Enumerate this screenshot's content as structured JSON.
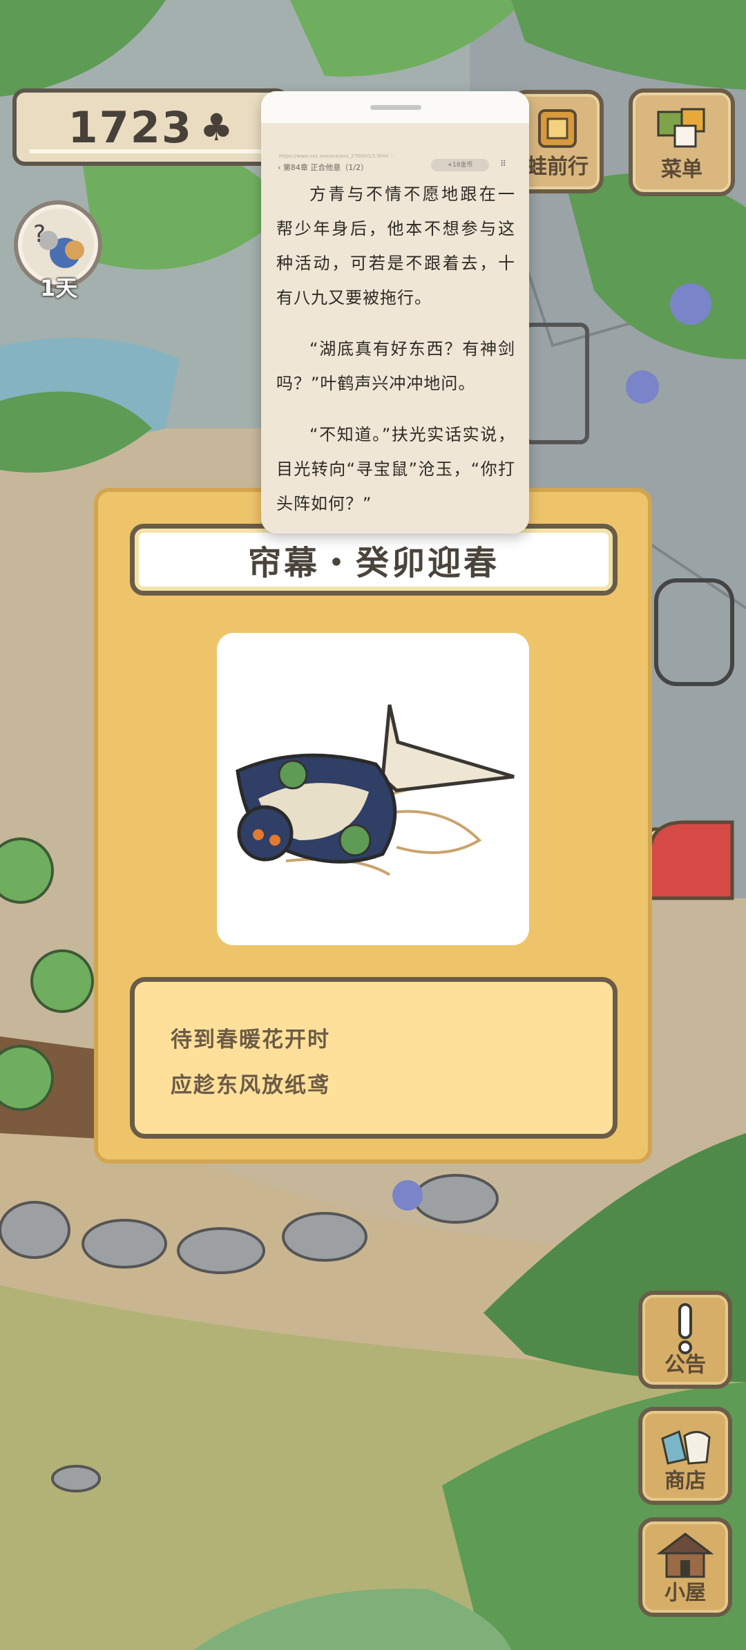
{
  "counter": {
    "value": "1723",
    "icon": "clover-icon"
  },
  "day_badge": {
    "label": "1天"
  },
  "top_buttons": [
    {
      "name": "frog-travel",
      "label": "蛙前行"
    },
    {
      "name": "menu",
      "label": "菜单"
    }
  ],
  "reader": {
    "url": "https://www.xxx.xxx/xxx/xxx_27000/1/1.html ···",
    "chapter": "‹ 第84章 正合他意（1/2）",
    "coin_pill": "+18金币",
    "paragraphs": [
      "方青与不情不愿地跟在一帮少年身后，他本不想参与这种活动，可若是不跟着去，十有八九又要被拖行。",
      "“湖底真有好东西？有神剑吗？”叶鹤声兴冲冲地问。",
      "“不知道。”扶光实话实说，目光转向“寻宝鼠”沧玉，“你打头阵如何？”"
    ]
  },
  "card": {
    "title": "帘幕・癸卯迎春",
    "image_icon": "swallow-kite-icon",
    "desc_lines": [
      "待到春暖花开时",
      "应趁东风放纸鸢"
    ]
  },
  "side_buttons": [
    {
      "name": "announcement",
      "label": "公告",
      "icon": "exclamation-icon"
    },
    {
      "name": "shop",
      "label": "商店",
      "icon": "bag-icon"
    },
    {
      "name": "house",
      "label": "小屋",
      "icon": "house-icon"
    }
  ],
  "colors": {
    "card_bg": "#eec46b",
    "card_border": "#6a5c48",
    "desc_bg": "#ffe09a",
    "reader_bg": "#efe6d6",
    "wood": "#d6ae68"
  }
}
